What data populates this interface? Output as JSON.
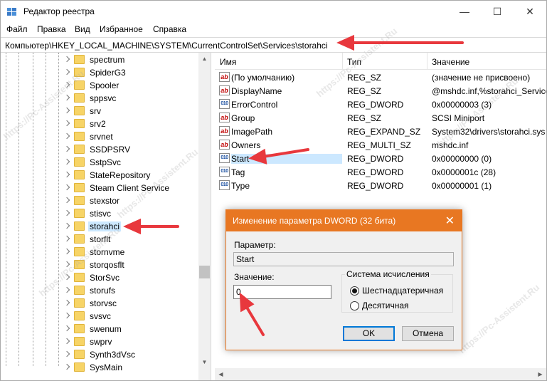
{
  "window": {
    "title": "Редактор реестра"
  },
  "menu": [
    "Файл",
    "Правка",
    "Вид",
    "Избранное",
    "Справка"
  ],
  "address": "Компьютер\\HKEY_LOCAL_MACHINE\\SYSTEM\\CurrentControlSet\\Services\\storahci",
  "tree": {
    "items": [
      "spectrum",
      "SpiderG3",
      "Spooler",
      "sppsvc",
      "srv",
      "srv2",
      "srvnet",
      "SSDPSRV",
      "SstpSvc",
      "StateRepository",
      "Steam Client Service",
      "stexstor",
      "stisvc",
      "storahci",
      "storflt",
      "stornvme",
      "storqosflt",
      "StorSvc",
      "storufs",
      "storvsc",
      "svsvc",
      "swenum",
      "swprv",
      "Synth3dVsc",
      "SysMain"
    ],
    "selected_index": 13
  },
  "list": {
    "headers": {
      "name": "Имя",
      "type": "Тип",
      "value": "Значение"
    },
    "rows": [
      {
        "icon": "ab",
        "name": "(По умолчанию)",
        "type": "REG_SZ",
        "value": "(значение не присвоено)"
      },
      {
        "icon": "ab",
        "name": "DisplayName",
        "type": "REG_SZ",
        "value": "@mshdc.inf,%storahci_Service"
      },
      {
        "icon": "dword",
        "name": "ErrorControl",
        "type": "REG_DWORD",
        "value": "0x00000003 (3)"
      },
      {
        "icon": "ab",
        "name": "Group",
        "type": "REG_SZ",
        "value": "SCSI Miniport"
      },
      {
        "icon": "ab",
        "name": "ImagePath",
        "type": "REG_EXPAND_SZ",
        "value": "System32\\drivers\\storahci.sys"
      },
      {
        "icon": "ab",
        "name": "Owners",
        "type": "REG_MULTI_SZ",
        "value": "mshdc.inf"
      },
      {
        "icon": "dword",
        "name": "Start",
        "type": "REG_DWORD",
        "value": "0x00000000 (0)"
      },
      {
        "icon": "dword",
        "name": "Tag",
        "type": "REG_DWORD",
        "value": "0x0000001c (28)"
      },
      {
        "icon": "dword",
        "name": "Type",
        "type": "REG_DWORD",
        "value": "0x00000001 (1)"
      }
    ]
  },
  "dialog": {
    "title": "Изменение параметра DWORD (32 бита)",
    "param_label": "Параметр:",
    "param_value": "Start",
    "value_label": "Значение:",
    "value": "0",
    "base_label": "Система исчисления",
    "radio_hex": "Шестнадцатеричная",
    "radio_dec": "Десятичная",
    "ok": "OK",
    "cancel": "Отмена"
  },
  "watermark": "https://Pc-Assistent.Ru",
  "colors": {
    "accent": "#e87722",
    "selection": "#cce8ff",
    "arrow": "#e8383d"
  }
}
